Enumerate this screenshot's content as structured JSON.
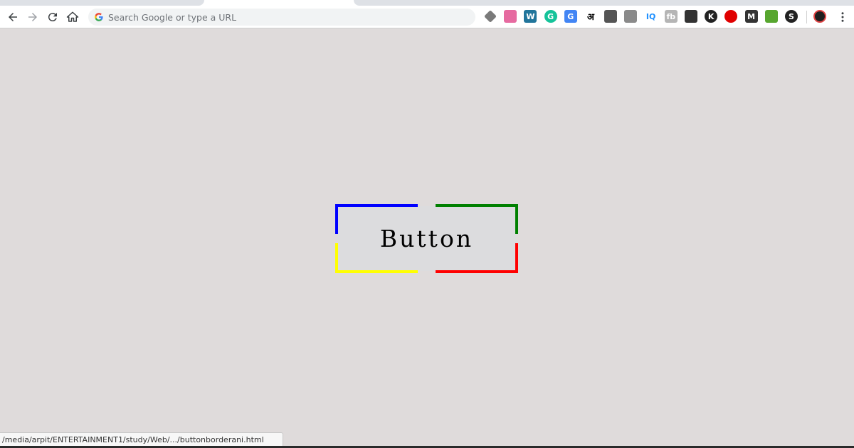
{
  "browser": {
    "omnibox": {
      "placeholder": "Search Google or type a URL",
      "value": ""
    },
    "nav": {
      "back_icon": "arrow-left-icon",
      "forward_icon": "arrow-right-icon",
      "reload_icon": "reload-icon",
      "home_icon": "home-icon"
    },
    "extensions": [
      {
        "name": "layers-extension-icon",
        "glyph": "",
        "color": "#7a7a7a"
      },
      {
        "name": "unicorn-extension-icon",
        "glyph": "",
        "color": "#e66aa0"
      },
      {
        "name": "wordpress-extension-icon",
        "glyph": "W",
        "color": "#21759b"
      },
      {
        "name": "grammarly-extension-icon",
        "glyph": "G",
        "color": "#15c39a"
      },
      {
        "name": "translate-extension-icon",
        "glyph": "G",
        "color": "#4285f4"
      },
      {
        "name": "hindi-extension-icon",
        "glyph": "अ",
        "color": "#000000"
      },
      {
        "name": "film-extension-icon",
        "glyph": "",
        "color": "#555555"
      },
      {
        "name": "box-extension-icon",
        "glyph": "",
        "color": "#8a8a8a"
      },
      {
        "name": "iq-extension-icon",
        "glyph": "IQ",
        "color": "#1e90ff"
      },
      {
        "name": "fb-extension-icon",
        "glyph": "fb",
        "color": "#b5b5b5"
      },
      {
        "name": "pen-extension-icon",
        "glyph": "",
        "color": "#333333"
      },
      {
        "name": "k-extension-icon",
        "glyph": "K",
        "color": "#222222"
      },
      {
        "name": "stop-extension-icon",
        "glyph": "",
        "color": "#e00000"
      },
      {
        "name": "m-extension-icon",
        "glyph": "M",
        "color": "#333333"
      },
      {
        "name": "print-extension-icon",
        "glyph": "",
        "color": "#57a62f"
      },
      {
        "name": "s-extension-icon",
        "glyph": "S",
        "color": "#222222"
      }
    ],
    "status_url": "/media/arpit/ENTERTAINMENT1/study/Web/.../buttonborderani.html"
  },
  "page": {
    "button_label": "Button",
    "corner_colors": {
      "top_left": "#0000ff",
      "top_right": "#008000",
      "bottom_left": "#ffff00",
      "bottom_right": "#ff0000"
    },
    "background": "#dfdbdb"
  }
}
